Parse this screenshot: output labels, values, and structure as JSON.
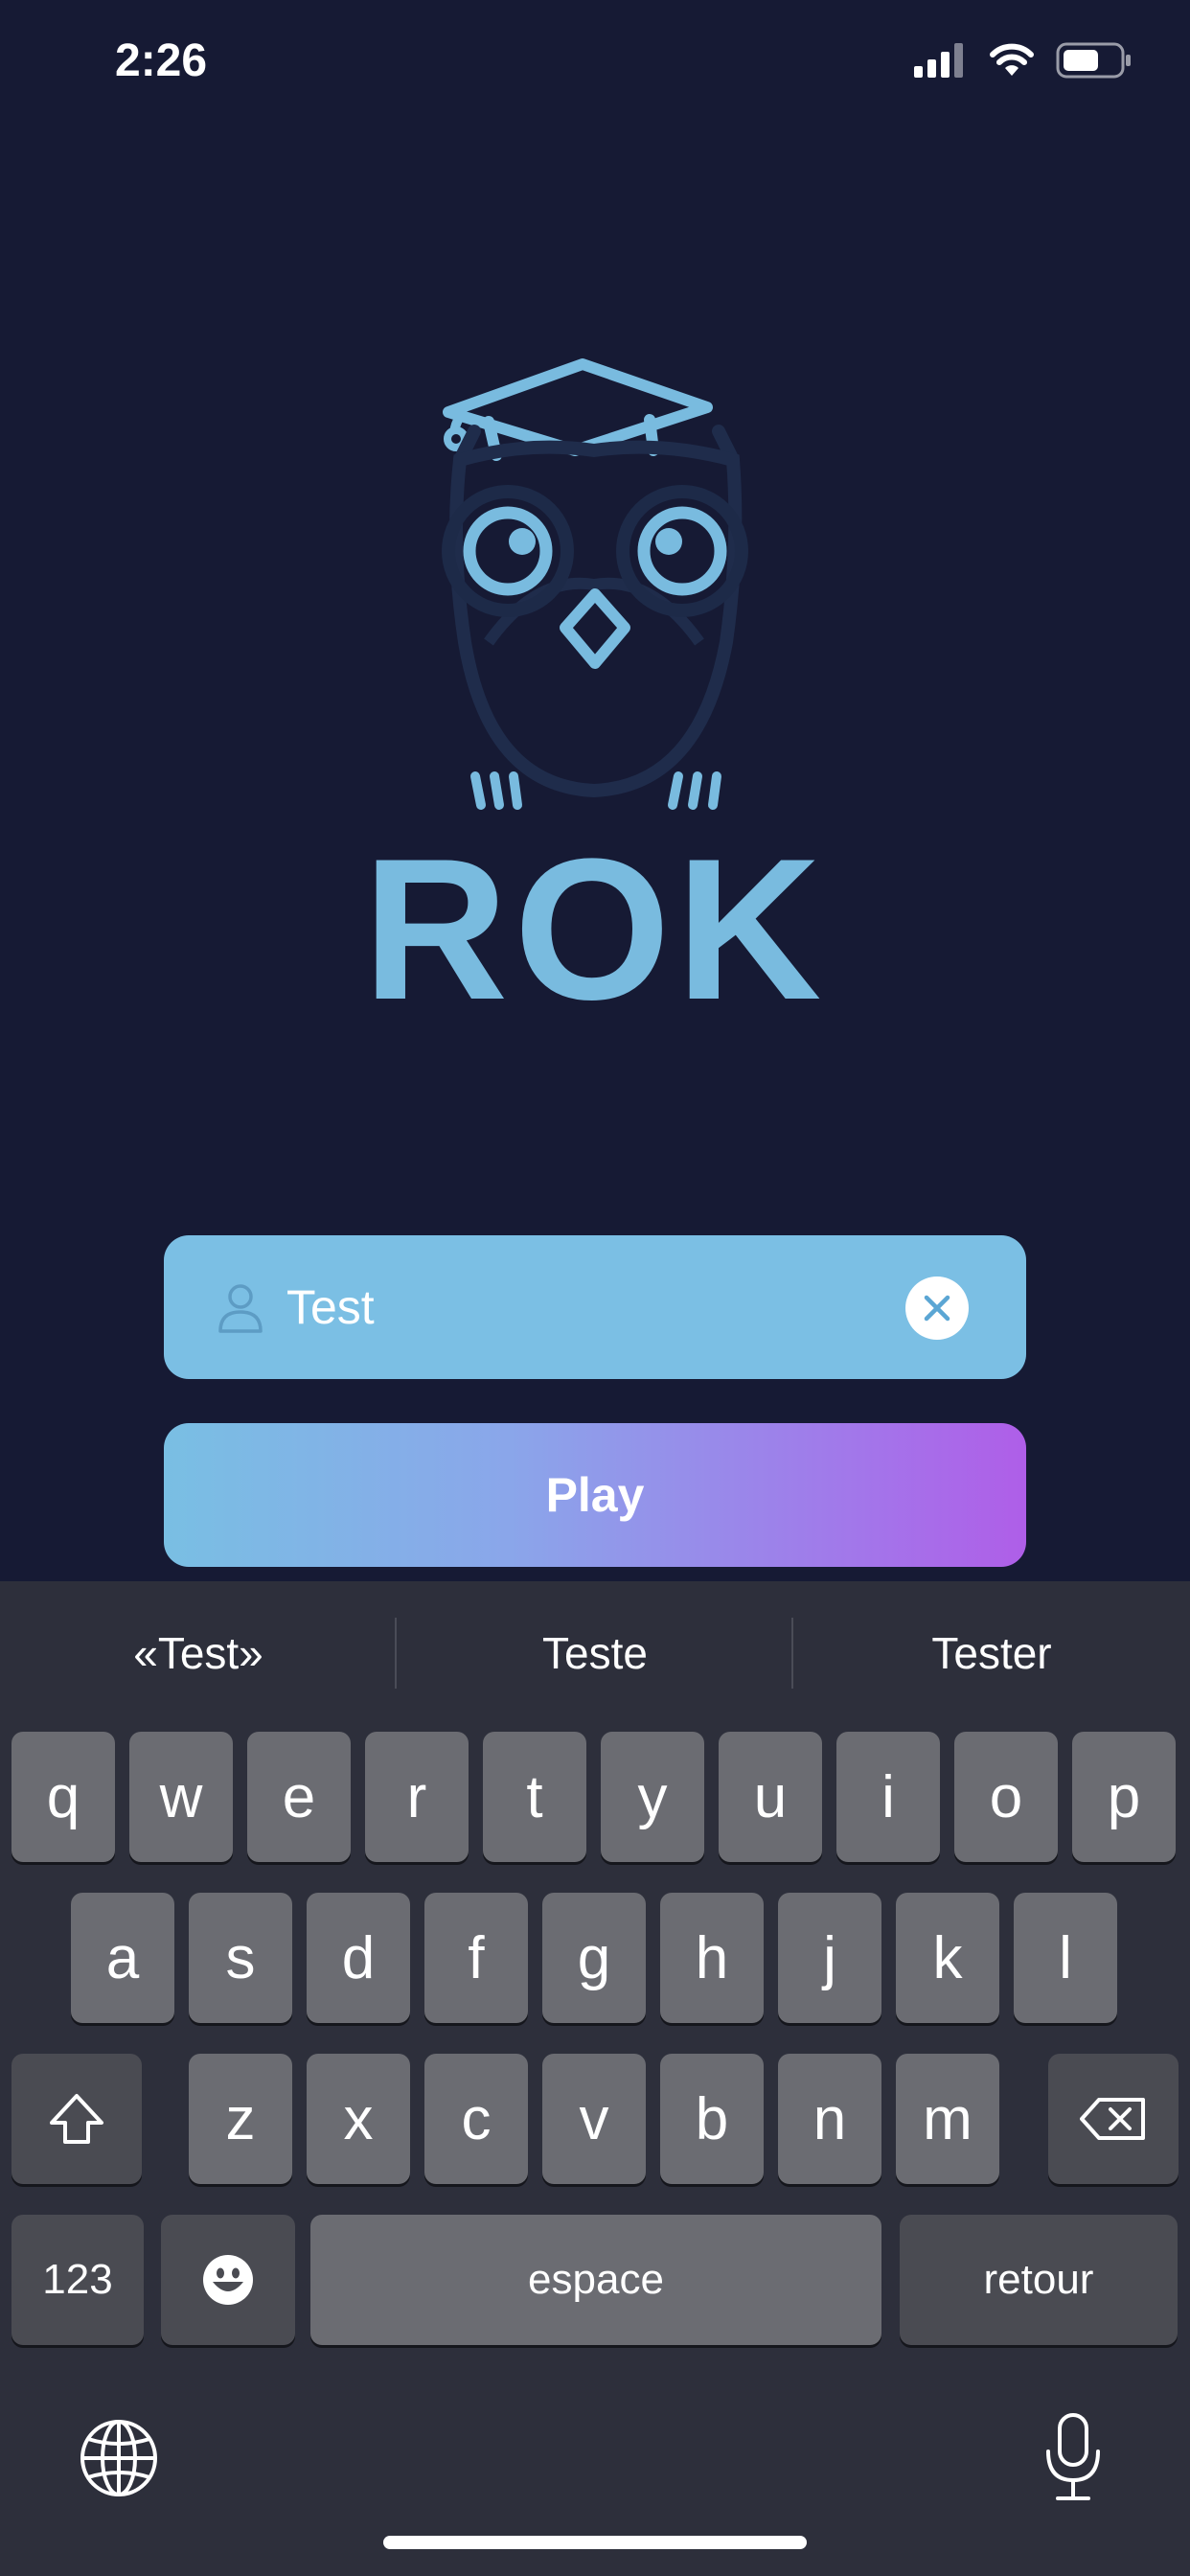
{
  "status_bar": {
    "time": "2:26"
  },
  "logo": {
    "text": "ROK"
  },
  "name_field": {
    "value": "Test"
  },
  "play_button": {
    "label": "Play"
  },
  "keyboard": {
    "suggestions": [
      "«Test»",
      "Teste",
      "Tester"
    ],
    "row1": [
      "q",
      "w",
      "e",
      "r",
      "t",
      "y",
      "u",
      "i",
      "o",
      "p"
    ],
    "row2": [
      "a",
      "s",
      "d",
      "f",
      "g",
      "h",
      "j",
      "k",
      "l"
    ],
    "row3": [
      "z",
      "x",
      "c",
      "v",
      "b",
      "n",
      "m"
    ],
    "numbers_key": "123",
    "space_key": "espace",
    "return_key": "retour"
  },
  "colors": {
    "background": "#161a34",
    "accent": "#7bbfe4",
    "play_gradient_start": "#79bfe3",
    "play_gradient_end": "#af5ee8",
    "keyboard_bg": "#2d2f3b",
    "key": "#6b6c72",
    "key_dark": "#4a4b52"
  }
}
